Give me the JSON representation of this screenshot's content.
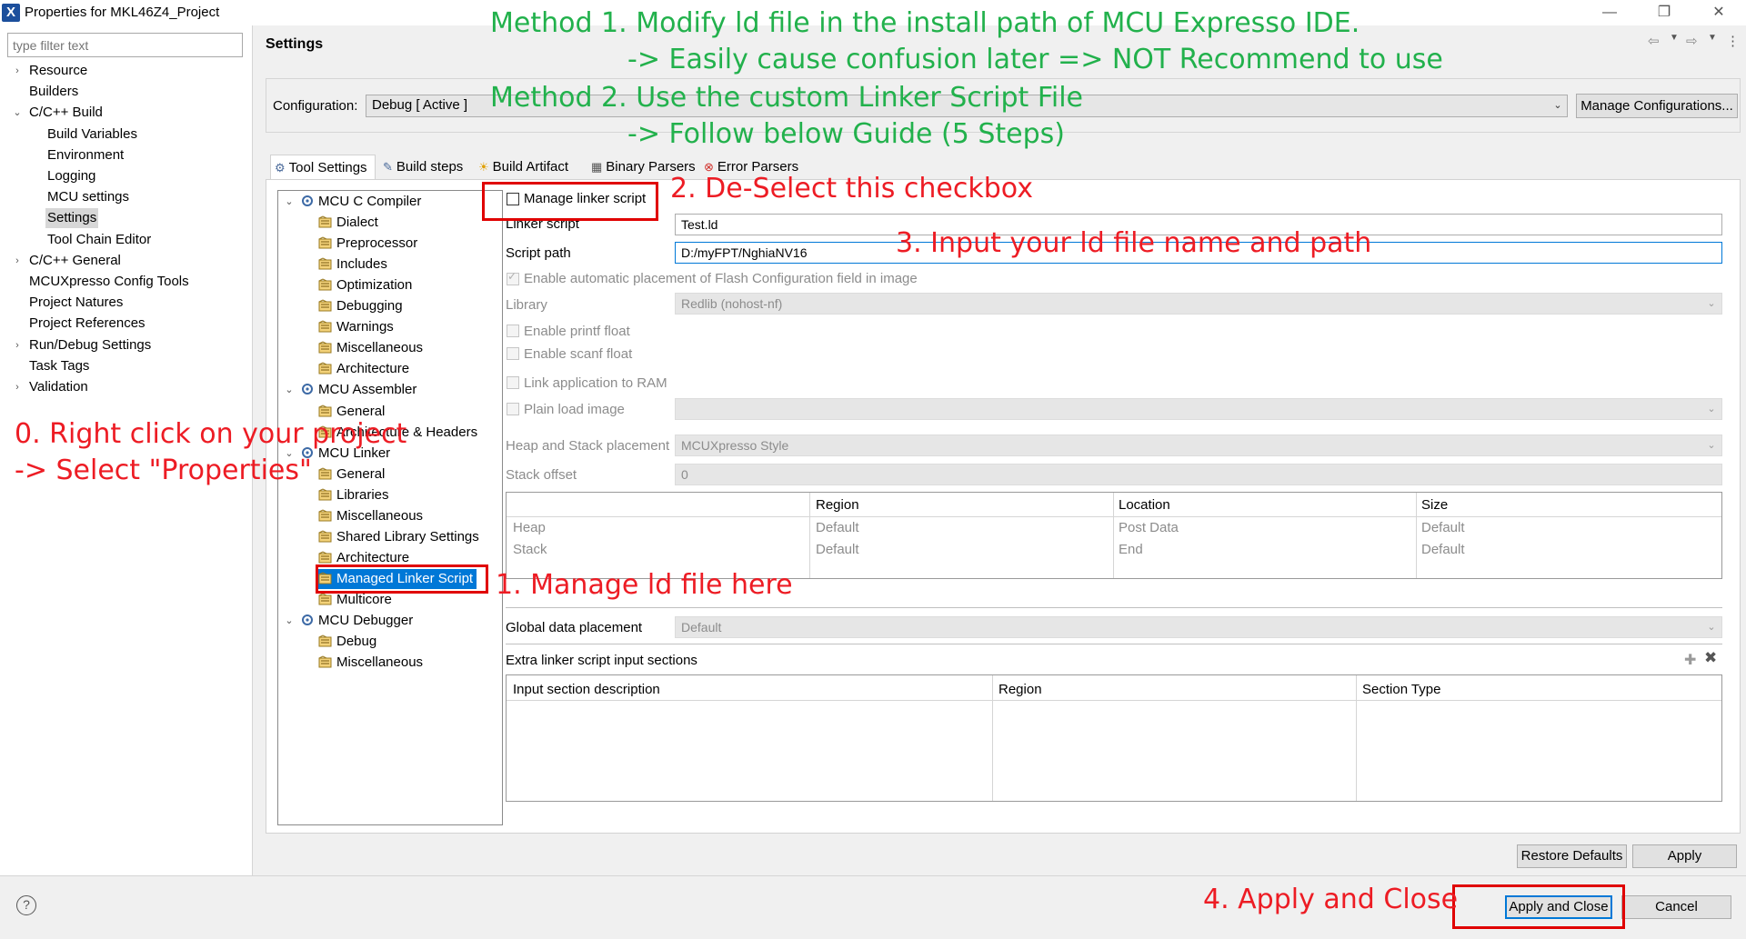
{
  "window": {
    "app_icon_letter": "X",
    "title": "Properties for MKL46Z4_Project",
    "minimize": "—",
    "restore": "❐",
    "close": "✕"
  },
  "left": {
    "filter_placeholder": "type filter text",
    "items": [
      {
        "label": "Resource",
        "twisty": "›"
      },
      {
        "label": "Builders",
        "twisty": ""
      },
      {
        "label": "C/C++ Build",
        "twisty": "⌄"
      },
      {
        "label": "Build Variables",
        "twisty": ""
      },
      {
        "label": "Environment",
        "twisty": ""
      },
      {
        "label": "Logging",
        "twisty": ""
      },
      {
        "label": "MCU settings",
        "twisty": ""
      },
      {
        "label": "Settings",
        "twisty": "",
        "selected": true
      },
      {
        "label": "Tool Chain Editor",
        "twisty": ""
      },
      {
        "label": "C/C++ General",
        "twisty": "›"
      },
      {
        "label": "MCUXpresso Config Tools",
        "twisty": ""
      },
      {
        "label": "Project Natures",
        "twisty": ""
      },
      {
        "label": "Project References",
        "twisty": ""
      },
      {
        "label": "Run/Debug Settings",
        "twisty": "›"
      },
      {
        "label": "Task Tags",
        "twisty": ""
      },
      {
        "label": "Validation",
        "twisty": "›"
      }
    ]
  },
  "header": {
    "title": "Settings",
    "nav_back": "⇦",
    "nav_fwd": "⇨",
    "menu": "⋮"
  },
  "config": {
    "label": "Configuration:",
    "value": "Debug  [ Active ]",
    "manage_button": "Manage Configurations..."
  },
  "tabs": [
    {
      "label": "Tool Settings",
      "icon": "tool-settings-icon",
      "active": true
    },
    {
      "label": "Build steps",
      "icon": "build-steps-icon"
    },
    {
      "label": "Build Artifact",
      "icon": "build-artifact-icon"
    },
    {
      "label": "Binary Parsers",
      "icon": "binary-parsers-icon"
    },
    {
      "label": "Error Parsers",
      "icon": "error-parsers-icon"
    }
  ],
  "tree": [
    {
      "label": "MCU C Compiler",
      "level": 0,
      "twisty": "⌄"
    },
    {
      "label": "Dialect",
      "level": 1
    },
    {
      "label": "Preprocessor",
      "level": 1
    },
    {
      "label": "Includes",
      "level": 1
    },
    {
      "label": "Optimization",
      "level": 1
    },
    {
      "label": "Debugging",
      "level": 1
    },
    {
      "label": "Warnings",
      "level": 1
    },
    {
      "label": "Miscellaneous",
      "level": 1
    },
    {
      "label": "Architecture",
      "level": 1
    },
    {
      "label": "MCU Assembler",
      "level": 0,
      "twisty": "⌄"
    },
    {
      "label": "General",
      "level": 1
    },
    {
      "label": "Architecture & Headers",
      "level": 1
    },
    {
      "label": "MCU Linker",
      "level": 0,
      "twisty": "⌄"
    },
    {
      "label": "General",
      "level": 1
    },
    {
      "label": "Libraries",
      "level": 1
    },
    {
      "label": "Miscellaneous",
      "level": 1
    },
    {
      "label": "Shared Library Settings",
      "level": 1
    },
    {
      "label": "Architecture",
      "level": 1
    },
    {
      "label": "Managed Linker Script",
      "level": 1,
      "selected": true
    },
    {
      "label": "Multicore",
      "level": 1
    },
    {
      "label": "MCU Debugger",
      "level": 0,
      "twisty": "⌄"
    },
    {
      "label": "Debug",
      "level": 1
    },
    {
      "label": "Miscellaneous",
      "level": 1
    }
  ],
  "form": {
    "manage_linker_script": "Manage linker script",
    "linker_script_label": "Linker script",
    "linker_script_value": "Test.ld",
    "script_path_label": "Script path",
    "script_path_value": "D:/myFPT/NghiaNV16",
    "auto_flash_config": "Enable automatic placement of Flash Configuration field in image",
    "library_label": "Library",
    "library_value": "Redlib (nohost-nf)",
    "printf_float": "Enable printf float",
    "scanf_float": "Enable scanf float",
    "link_to_ram": "Link application to RAM",
    "plain_load_image": "Plain load image",
    "heap_stack_label": "Heap and Stack placement",
    "heap_stack_value": "MCUXpresso Style",
    "stack_offset_label": "Stack offset",
    "stack_offset_value": "0",
    "hs_table": {
      "headers": [
        "Region",
        "Location",
        "Size"
      ],
      "rows": [
        {
          "name": "Heap",
          "region": "Default",
          "location": "Post Data",
          "size": "Default"
        },
        {
          "name": "Stack",
          "region": "Default",
          "location": "End",
          "size": "Default"
        }
      ]
    },
    "global_data_label": "Global data placement",
    "global_data_value": "Default",
    "extra_sections_label": "Extra linker script input sections",
    "extra_table_headers": [
      "Input section description",
      "Region",
      "Section Type"
    ]
  },
  "buttons": {
    "restore_defaults": "Restore Defaults",
    "apply": "Apply",
    "apply_close": "Apply and Close",
    "cancel": "Cancel",
    "help": "?"
  },
  "annotations": {
    "method1_line1": "Method 1. Modify ld file in the install path of MCU Expresso IDE.",
    "method1_line2": "-> Easily cause confusion later => NOT Recommend to use",
    "method2_line1": "Method 2. Use the custom Linker Script File",
    "method2_line2": "-> Follow below Guide  (5 Steps)",
    "step0_line1": "0. Right click on your project",
    "step0_line2": "-> Select \"Properties\"",
    "step1": "1. Manage ld file here",
    "step2": "2. De-Select this checkbox",
    "step3": "3. Input your ld file name and path",
    "step4": "4. Apply and Close"
  },
  "colors": {
    "annotation_green": "#22b14c",
    "annotation_red": "#ed1c24",
    "highlight_box": "#e00000",
    "focus_border": "#0078d7"
  }
}
